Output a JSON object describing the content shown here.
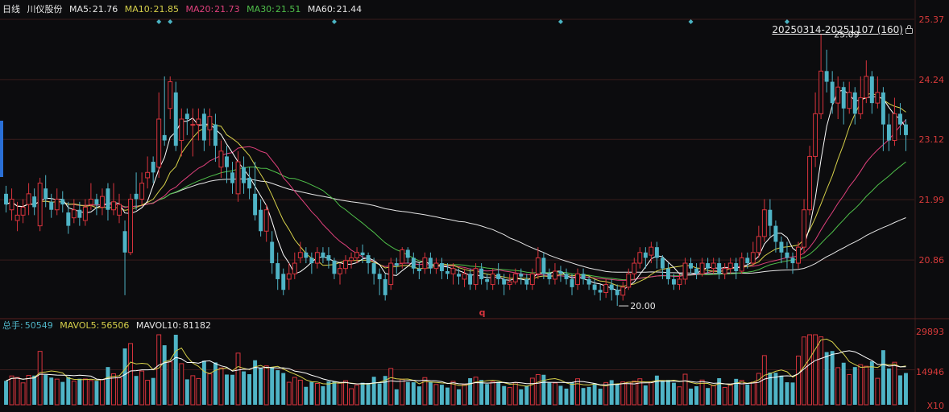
{
  "header": {
    "period": "日线",
    "stock_name": "川仪股份",
    "ma5_label": "MA5:",
    "ma5_value": "21.76",
    "ma10_label": "MA10:",
    "ma10_value": "21.85",
    "ma20_label": "MA20:",
    "ma20_value": "21.73",
    "ma30_label": "MA30:",
    "ma30_value": "21.51",
    "ma60_label": "MA60:",
    "ma60_value": "21.44"
  },
  "range_label": "20250314-20251107 (160)",
  "volume_header": {
    "label": "总手:",
    "value": "50549",
    "mavol5_label": "MAVOL5:",
    "mavol5_value": "56506",
    "mavol10_label": "MAVOL10:",
    "mavol10_value": "81182"
  },
  "annotations": {
    "high": "25.09",
    "low": "20.00",
    "marker": "q"
  },
  "colors": {
    "up": "#d8343d",
    "down": "#4fb4c6",
    "ma5": "#ffffff",
    "ma10": "#d6d04a",
    "ma20": "#e0417c",
    "ma30": "#4fbf4a",
    "ma60": "#e6e6e6",
    "grid": "#3a1c1c",
    "axis_text": "#d83a3a",
    "diamond": "#4ab3c2"
  },
  "chart_data": [
    {
      "type": "candlestick",
      "title": "川仪股份 日线",
      "y_ticks": [
        "25.37",
        "24.24",
        "23.12",
        "21.99",
        "20.86"
      ],
      "ylim": [
        19.73,
        25.37
      ],
      "candles": [
        [
          22.1,
          21.9,
          22.25,
          21.75
        ],
        [
          21.8,
          22.0,
          22.2,
          21.6
        ],
        [
          21.6,
          21.7,
          21.95,
          21.4
        ],
        [
          21.7,
          21.85,
          22.0,
          21.55
        ],
        [
          21.9,
          22.1,
          22.3,
          21.7
        ],
        [
          22.05,
          21.85,
          22.2,
          21.7
        ],
        [
          21.5,
          22.3,
          22.4,
          21.4
        ],
        [
          22.2,
          22.0,
          22.45,
          21.85
        ],
        [
          21.95,
          21.8,
          22.1,
          21.65
        ],
        [
          21.8,
          22.0,
          22.2,
          21.7
        ],
        [
          22.0,
          21.9,
          22.15,
          21.75
        ],
        [
          21.75,
          21.5,
          21.95,
          21.35
        ],
        [
          21.65,
          21.8,
          22.0,
          21.55
        ],
        [
          21.8,
          21.65,
          21.95,
          21.5
        ],
        [
          21.6,
          21.85,
          22.0,
          21.5
        ],
        [
          21.9,
          22.0,
          22.3,
          21.8
        ],
        [
          22.0,
          21.9,
          22.1,
          21.7
        ],
        [
          21.85,
          22.05,
          22.2,
          21.7
        ],
        [
          22.2,
          21.8,
          22.3,
          21.6
        ],
        [
          21.8,
          21.95,
          22.3,
          21.7
        ],
        [
          21.7,
          21.9,
          22.1,
          21.55
        ],
        [
          21.4,
          21.0,
          21.6,
          20.2
        ],
        [
          21.0,
          22.0,
          22.1,
          20.95
        ],
        [
          22.1,
          22.0,
          22.5,
          21.8
        ],
        [
          22.0,
          22.3,
          22.5,
          21.9
        ],
        [
          22.4,
          22.5,
          22.8,
          22.2
        ],
        [
          22.7,
          22.5,
          22.8,
          22.3
        ],
        [
          22.6,
          23.5,
          24.0,
          22.4
        ],
        [
          23.2,
          23.1,
          24.3,
          23.0
        ],
        [
          23.7,
          24.2,
          24.3,
          23.5
        ],
        [
          24.0,
          23.0,
          24.2,
          22.9
        ],
        [
          23.1,
          23.5,
          23.7,
          22.8
        ],
        [
          23.6,
          23.5,
          23.7,
          23.2
        ],
        [
          23.4,
          23.4,
          23.7,
          22.8
        ],
        [
          23.4,
          23.5,
          23.7,
          23.1
        ],
        [
          23.6,
          23.1,
          23.7,
          22.9
        ],
        [
          23.3,
          23.55,
          23.7,
          23.0
        ],
        [
          23.4,
          23.0,
          23.6,
          22.7
        ],
        [
          22.6,
          22.9,
          23.1,
          22.4
        ],
        [
          22.8,
          22.6,
          23.0,
          22.3
        ],
        [
          22.5,
          22.3,
          22.7,
          22.1
        ],
        [
          22.1,
          22.7,
          22.9,
          21.95
        ],
        [
          22.6,
          22.3,
          22.8,
          22.1
        ],
        [
          22.4,
          22.2,
          22.6,
          22.0
        ],
        [
          22.1,
          21.7,
          22.7,
          21.6
        ],
        [
          21.8,
          21.4,
          22.0,
          21.3
        ],
        [
          21.4,
          21.8,
          21.9,
          21.2
        ],
        [
          21.2,
          20.8,
          21.4,
          20.6
        ],
        [
          20.8,
          20.5,
          21.0,
          20.3
        ],
        [
          20.6,
          20.3,
          20.7,
          20.2
        ],
        [
          20.5,
          20.6,
          20.8,
          20.3
        ],
        [
          20.6,
          20.8,
          21.0,
          20.5
        ],
        [
          20.9,
          21.0,
          21.2,
          20.8
        ],
        [
          21.0,
          20.9,
          21.1,
          20.8
        ],
        [
          20.9,
          20.8,
          21.0,
          20.6
        ],
        [
          20.8,
          21.0,
          21.1,
          20.7
        ],
        [
          21.0,
          20.9,
          21.1,
          20.8
        ],
        [
          20.95,
          20.85,
          21.1,
          20.7
        ],
        [
          20.85,
          20.6,
          20.9,
          20.5
        ],
        [
          20.6,
          20.7,
          20.8,
          20.4
        ],
        [
          20.7,
          20.85,
          20.95,
          20.6
        ],
        [
          20.85,
          20.9,
          21.0,
          20.7
        ],
        [
          20.9,
          21.0,
          21.1,
          20.8
        ],
        [
          21.0,
          20.95,
          21.15,
          20.8
        ],
        [
          20.95,
          20.8,
          21.0,
          20.6
        ],
        [
          20.8,
          20.6,
          20.9,
          20.4
        ],
        [
          20.6,
          20.5,
          20.7,
          20.2
        ],
        [
          20.5,
          20.2,
          20.6,
          20.1
        ],
        [
          20.4,
          20.8,
          20.9,
          20.3
        ],
        [
          20.8,
          20.75,
          20.9,
          20.6
        ],
        [
          20.8,
          21.05,
          21.1,
          20.7
        ],
        [
          21.05,
          20.9,
          21.1,
          20.8
        ],
        [
          20.9,
          20.7,
          21.0,
          20.6
        ],
        [
          20.7,
          20.65,
          20.8,
          20.5
        ],
        [
          20.7,
          20.9,
          21.0,
          20.6
        ],
        [
          20.9,
          20.7,
          21.0,
          20.6
        ],
        [
          20.7,
          20.8,
          20.9,
          20.6
        ],
        [
          20.8,
          20.65,
          20.9,
          20.5
        ],
        [
          20.65,
          20.6,
          20.8,
          20.5
        ],
        [
          20.6,
          20.7,
          20.8,
          20.4
        ],
        [
          20.6,
          20.55,
          20.7,
          20.4
        ],
        [
          20.5,
          20.6,
          20.7,
          20.35
        ],
        [
          20.6,
          20.4,
          20.7,
          20.3
        ],
        [
          20.4,
          20.7,
          20.8,
          20.3
        ],
        [
          20.7,
          20.5,
          20.8,
          20.4
        ],
        [
          20.5,
          20.45,
          20.6,
          20.3
        ],
        [
          20.4,
          20.6,
          20.7,
          20.3
        ],
        [
          20.6,
          20.5,
          20.8,
          20.4
        ],
        [
          20.5,
          20.4,
          20.6,
          20.2
        ],
        [
          20.4,
          20.45,
          20.6,
          20.3
        ],
        [
          20.45,
          20.6,
          20.7,
          20.4
        ],
        [
          20.6,
          20.55,
          20.7,
          20.4
        ],
        [
          20.5,
          20.4,
          20.6,
          20.3
        ],
        [
          20.4,
          20.6,
          20.7,
          20.3
        ],
        [
          20.6,
          20.9,
          21.1,
          20.5
        ],
        [
          20.9,
          20.6,
          21.0,
          20.5
        ],
        [
          20.6,
          20.5,
          20.7,
          20.4
        ],
        [
          20.5,
          20.65,
          20.8,
          20.4
        ],
        [
          20.65,
          20.6,
          20.75,
          20.45
        ],
        [
          20.6,
          20.5,
          20.7,
          20.4
        ],
        [
          20.5,
          20.35,
          20.6,
          20.2
        ],
        [
          20.4,
          20.6,
          20.7,
          20.3
        ],
        [
          20.6,
          20.5,
          20.7,
          20.4
        ],
        [
          20.5,
          20.4,
          20.55,
          20.3
        ],
        [
          20.4,
          20.3,
          20.5,
          20.2
        ],
        [
          20.3,
          20.25,
          20.4,
          20.1
        ],
        [
          20.25,
          20.4,
          20.5,
          20.15
        ],
        [
          20.4,
          20.3,
          20.5,
          20.1
        ],
        [
          20.3,
          20.2,
          20.4,
          20.0
        ],
        [
          20.2,
          20.35,
          20.45,
          20.1
        ],
        [
          20.35,
          20.6,
          20.7,
          20.3
        ],
        [
          20.6,
          20.8,
          20.9,
          20.5
        ],
        [
          20.8,
          21.0,
          21.1,
          20.7
        ],
        [
          21.0,
          20.9,
          21.1,
          20.7
        ],
        [
          20.95,
          21.1,
          21.2,
          20.8
        ],
        [
          21.1,
          20.9,
          21.2,
          20.7
        ],
        [
          20.9,
          20.7,
          20.95,
          20.5
        ],
        [
          20.7,
          20.5,
          20.8,
          20.4
        ],
        [
          20.5,
          20.4,
          20.6,
          20.3
        ],
        [
          20.4,
          20.5,
          20.6,
          20.3
        ],
        [
          20.5,
          20.8,
          20.9,
          20.4
        ],
        [
          20.8,
          20.7,
          20.9,
          20.6
        ],
        [
          20.7,
          20.6,
          20.8,
          20.5
        ],
        [
          20.6,
          20.8,
          20.9,
          20.55
        ],
        [
          20.8,
          20.7,
          20.9,
          20.6
        ],
        [
          20.7,
          20.8,
          20.9,
          20.6
        ],
        [
          20.8,
          20.6,
          20.9,
          20.5
        ],
        [
          20.6,
          20.7,
          20.8,
          20.5
        ],
        [
          20.7,
          20.8,
          20.9,
          20.6
        ],
        [
          20.8,
          20.65,
          20.9,
          20.5
        ],
        [
          20.65,
          20.9,
          21.0,
          20.6
        ],
        [
          20.9,
          20.8,
          21.0,
          20.7
        ],
        [
          20.8,
          21.0,
          21.2,
          20.75
        ],
        [
          21.0,
          21.3,
          21.5,
          20.9
        ],
        [
          21.3,
          21.8,
          22.0,
          21.2
        ],
        [
          21.8,
          21.5,
          22.0,
          21.3
        ],
        [
          21.5,
          21.2,
          21.6,
          21.0
        ],
        [
          21.2,
          21.0,
          21.3,
          20.8
        ],
        [
          21.0,
          20.9,
          21.2,
          20.7
        ],
        [
          20.9,
          20.8,
          21.0,
          20.6
        ],
        [
          20.8,
          21.1,
          21.2,
          20.7
        ],
        [
          21.1,
          21.8,
          22.0,
          21.0
        ],
        [
          21.8,
          22.8,
          23.0,
          21.7
        ],
        [
          22.8,
          23.6,
          24.0,
          22.6
        ],
        [
          23.6,
          24.4,
          25.09,
          23.5
        ],
        [
          24.4,
          24.2,
          24.8,
          24.0
        ],
        [
          24.2,
          23.8,
          24.4,
          23.6
        ],
        [
          23.8,
          24.1,
          24.3,
          23.5
        ],
        [
          24.1,
          23.7,
          24.2,
          23.4
        ],
        [
          23.7,
          24.0,
          24.2,
          23.6
        ],
        [
          24.0,
          23.6,
          24.1,
          23.4
        ],
        [
          23.6,
          23.9,
          24.3,
          23.5
        ],
        [
          23.9,
          24.3,
          24.6,
          23.8
        ],
        [
          24.3,
          23.8,
          24.4,
          23.6
        ],
        [
          23.8,
          24.0,
          24.3,
          23.7
        ],
        [
          24.0,
          23.4,
          24.1,
          22.9
        ],
        [
          23.4,
          23.1,
          23.6,
          22.9
        ],
        [
          23.1,
          23.6,
          23.9,
          23.0
        ],
        [
          23.6,
          23.4,
          23.8,
          23.2
        ],
        [
          23.4,
          23.2,
          23.5,
          22.9
        ]
      ]
    },
    {
      "type": "bar",
      "title": "总手",
      "y_ticks": [
        "29893",
        "14946",
        "X10"
      ],
      "ylim": [
        0,
        29893
      ],
      "unit": "X10",
      "values_up_down": "same candle order as price chart"
    }
  ]
}
